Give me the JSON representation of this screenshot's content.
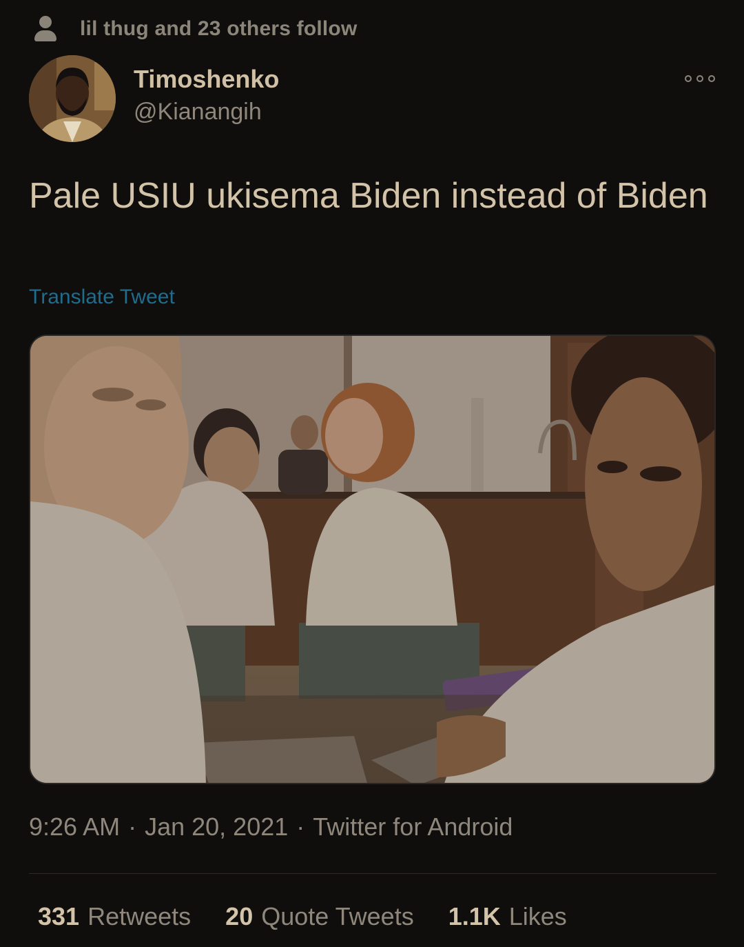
{
  "social_context": {
    "icon": "person-icon",
    "text": "lil thug and 23 others follow"
  },
  "author": {
    "display_name": "Timoshenko",
    "handle": "@Kianangih"
  },
  "more_icon": "ellipsis-icon",
  "tweet": {
    "text": "Pale USIU ukisema Biden instead of Biden",
    "translate_label": "Translate Tweet"
  },
  "meta": {
    "time": "9:26 AM",
    "date": "Jan 20, 2021",
    "source": "Twitter for Android",
    "separator": "·"
  },
  "stats": [
    {
      "count": "331",
      "label": "Retweets"
    },
    {
      "count": "20",
      "label": "Quote Tweets"
    },
    {
      "count": "1.1K",
      "label": "Likes"
    }
  ],
  "colors": {
    "background": "#0f0e0d",
    "text_primary": "#d3c4a9",
    "text_secondary": "#8f877b",
    "link": "#1f6d8e"
  }
}
